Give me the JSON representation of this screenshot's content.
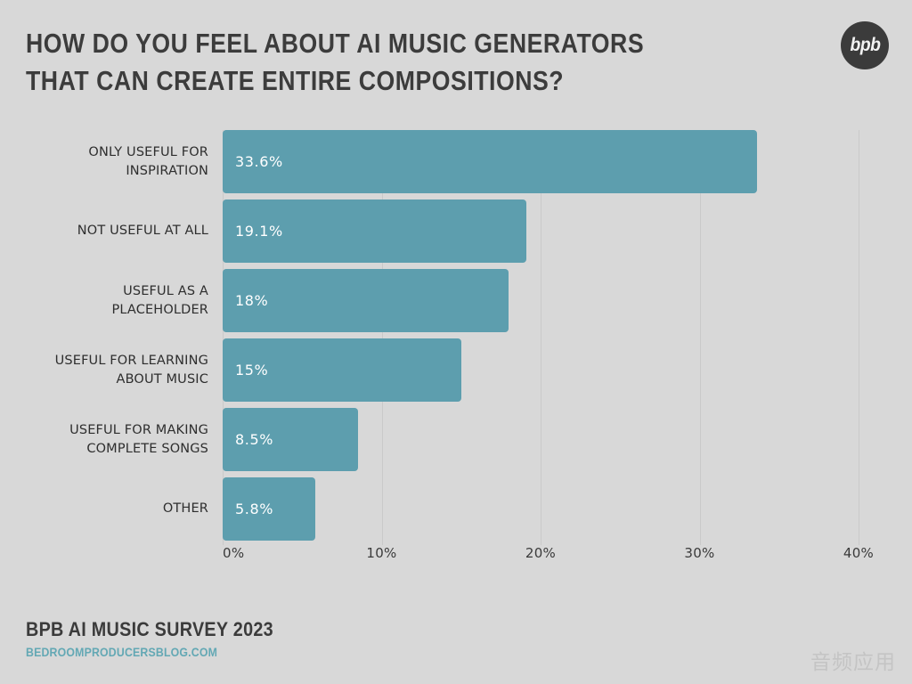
{
  "header": {
    "title": "How do you feel about AI music generators that can create entire compositions?",
    "logo_text": "bpb",
    "logo_name": "bpb-logo"
  },
  "footer": {
    "survey_title": "BPB AI Music Survey 2023",
    "url": "bedroomproducersblog.com",
    "watermark": "音频应用"
  },
  "colors": {
    "background": "#d8d8d8",
    "bar": "#5d9eae",
    "title_text": "#3c3c3c",
    "label_text": "#2e2e2e",
    "value_text": "#ffffff",
    "gridline": "#cacaca",
    "accent_link": "#63a8b4",
    "logo_circle": "#3b3b3b"
  },
  "chart_data": {
    "type": "bar",
    "orientation": "horizontal",
    "title": "How do you feel about AI music generators that can create entire compositions?",
    "xlabel": "",
    "ylabel": "",
    "xlim": [
      0,
      40
    ],
    "grid": true,
    "legend": "none",
    "xticks": [
      "0%",
      "10%",
      "20%",
      "30%",
      "40%"
    ],
    "xtick_values": [
      0,
      10,
      20,
      30,
      40
    ],
    "categories": [
      "Only useful for inspiration",
      "Not useful at all",
      "Useful as a placeholder",
      "Useful for learning about music",
      "Useful for making complete songs",
      "Other"
    ],
    "values": [
      33.6,
      19.1,
      18,
      15,
      8.5,
      5.8
    ],
    "value_labels": [
      "33.6%",
      "19.1%",
      "18%",
      "15%",
      "8.5%",
      "5.8%"
    ]
  },
  "bars": [
    {
      "label": "Only useful for inspiration",
      "label_lines": "ONLY USEFUL FOR\nINSPIRATION",
      "value": 33.6,
      "value_label": "33.6%"
    },
    {
      "label": "Not useful at all",
      "label_lines": "NOT USEFUL AT ALL",
      "value": 19.1,
      "value_label": "19.1%"
    },
    {
      "label": "Useful as a placeholder",
      "label_lines": "USEFUL AS A\nPLACEHOLDER",
      "value": 18,
      "value_label": "18%"
    },
    {
      "label": "Useful for learning about music",
      "label_lines": "USEFUL FOR LEARNING\nABOUT MUSIC",
      "value": 15,
      "value_label": "15%"
    },
    {
      "label": "Useful for making complete songs",
      "label_lines": "USEFUL FOR MAKING\nCOMPLETE SONGS",
      "value": 8.5,
      "value_label": "8.5%"
    },
    {
      "label": "Other",
      "label_lines": "OTHER",
      "value": 5.8,
      "value_label": "5.8%"
    }
  ]
}
